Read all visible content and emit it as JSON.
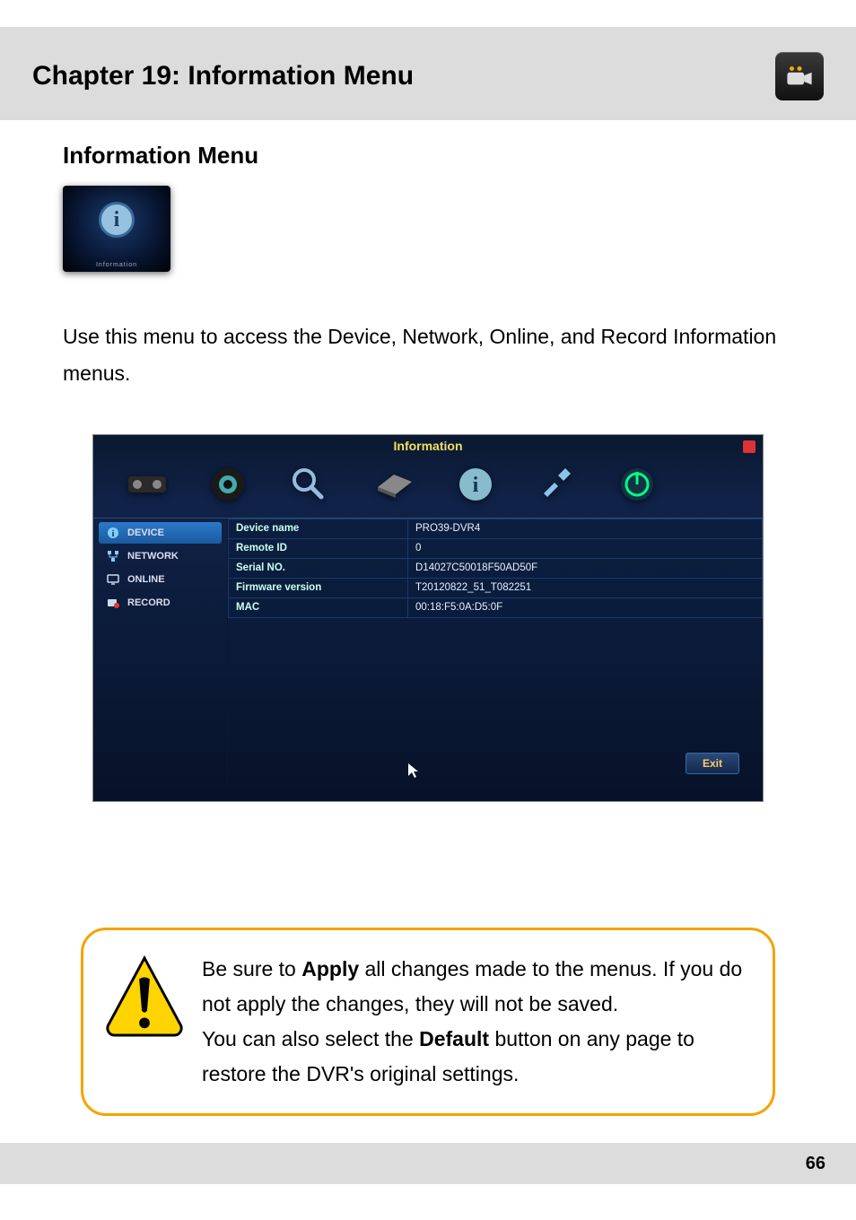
{
  "chapter": {
    "title": "Chapter 19: Information Menu"
  },
  "section": {
    "title": "Information Menu"
  },
  "thumb": {
    "caption": "Information"
  },
  "intro": "Use this menu to access the Device, Network, Online, and Record Information menus.",
  "dvr": {
    "title": "Information",
    "tabs": [
      {
        "label": "DEVICE",
        "active": true
      },
      {
        "label": "NETWORK",
        "active": false
      },
      {
        "label": "ONLINE",
        "active": false
      },
      {
        "label": "RECORD",
        "active": false
      }
    ],
    "rows": [
      {
        "label": "Device name",
        "value": "PRO39-DVR4"
      },
      {
        "label": "Remote ID",
        "value": "0"
      },
      {
        "label": "Serial NO.",
        "value": "D14027C50018F50AD50F"
      },
      {
        "label": "Firmware version",
        "value": "T20120822_51_T082251"
      },
      {
        "label": "MAC",
        "value": "00:18:F5:0A:D5:0F"
      }
    ],
    "exit": "Exit"
  },
  "warning": {
    "t1": "Be sure to ",
    "b1": "Apply",
    "t2": " all changes made to the menus. If you do not apply the changes, they will not be saved.",
    "t3": "You can also select the ",
    "b2": "Default",
    "t4": " button on any page to restore the DVR's original settings."
  },
  "page_number": "66"
}
